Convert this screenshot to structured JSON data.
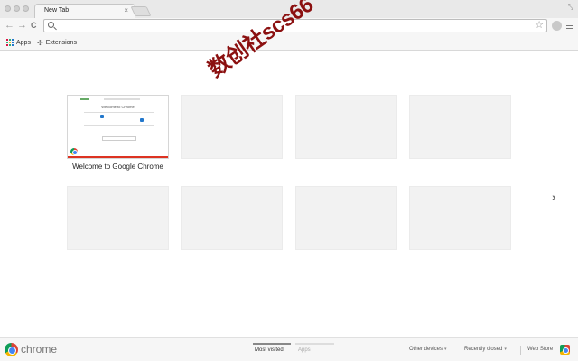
{
  "tab": {
    "title": "New Tab",
    "close": "×"
  },
  "window": {
    "resize_glyph": "⤡"
  },
  "toolbar": {
    "back": "←",
    "forward": "→",
    "reload": "C",
    "omnibox_value": "",
    "omnibox_placeholder": "",
    "star": "☆"
  },
  "bookmarks": [
    {
      "label": "Apps"
    },
    {
      "label": "Extensions"
    }
  ],
  "tiles": [
    {
      "label": "Welcome to Google Chrome",
      "thumb_title": "Welcome to Chrome"
    }
  ],
  "watermark": "数创社scs66",
  "next_glyph": "›",
  "footer": {
    "brand": "chrome",
    "tabs": [
      {
        "label": "Most visited",
        "active": true
      },
      {
        "label": "Apps",
        "active": false
      }
    ],
    "other_devices": "Other devices",
    "recently_closed": "Recently closed",
    "caret": "▾",
    "web_store": "Web Store"
  },
  "colors": {
    "active_tab_bar": "#888888",
    "inactive_tab_bar": "#dddddd",
    "tile_bg": "#f2f2f2",
    "accent_red": "#dd3322",
    "watermark": "#8b1010"
  }
}
